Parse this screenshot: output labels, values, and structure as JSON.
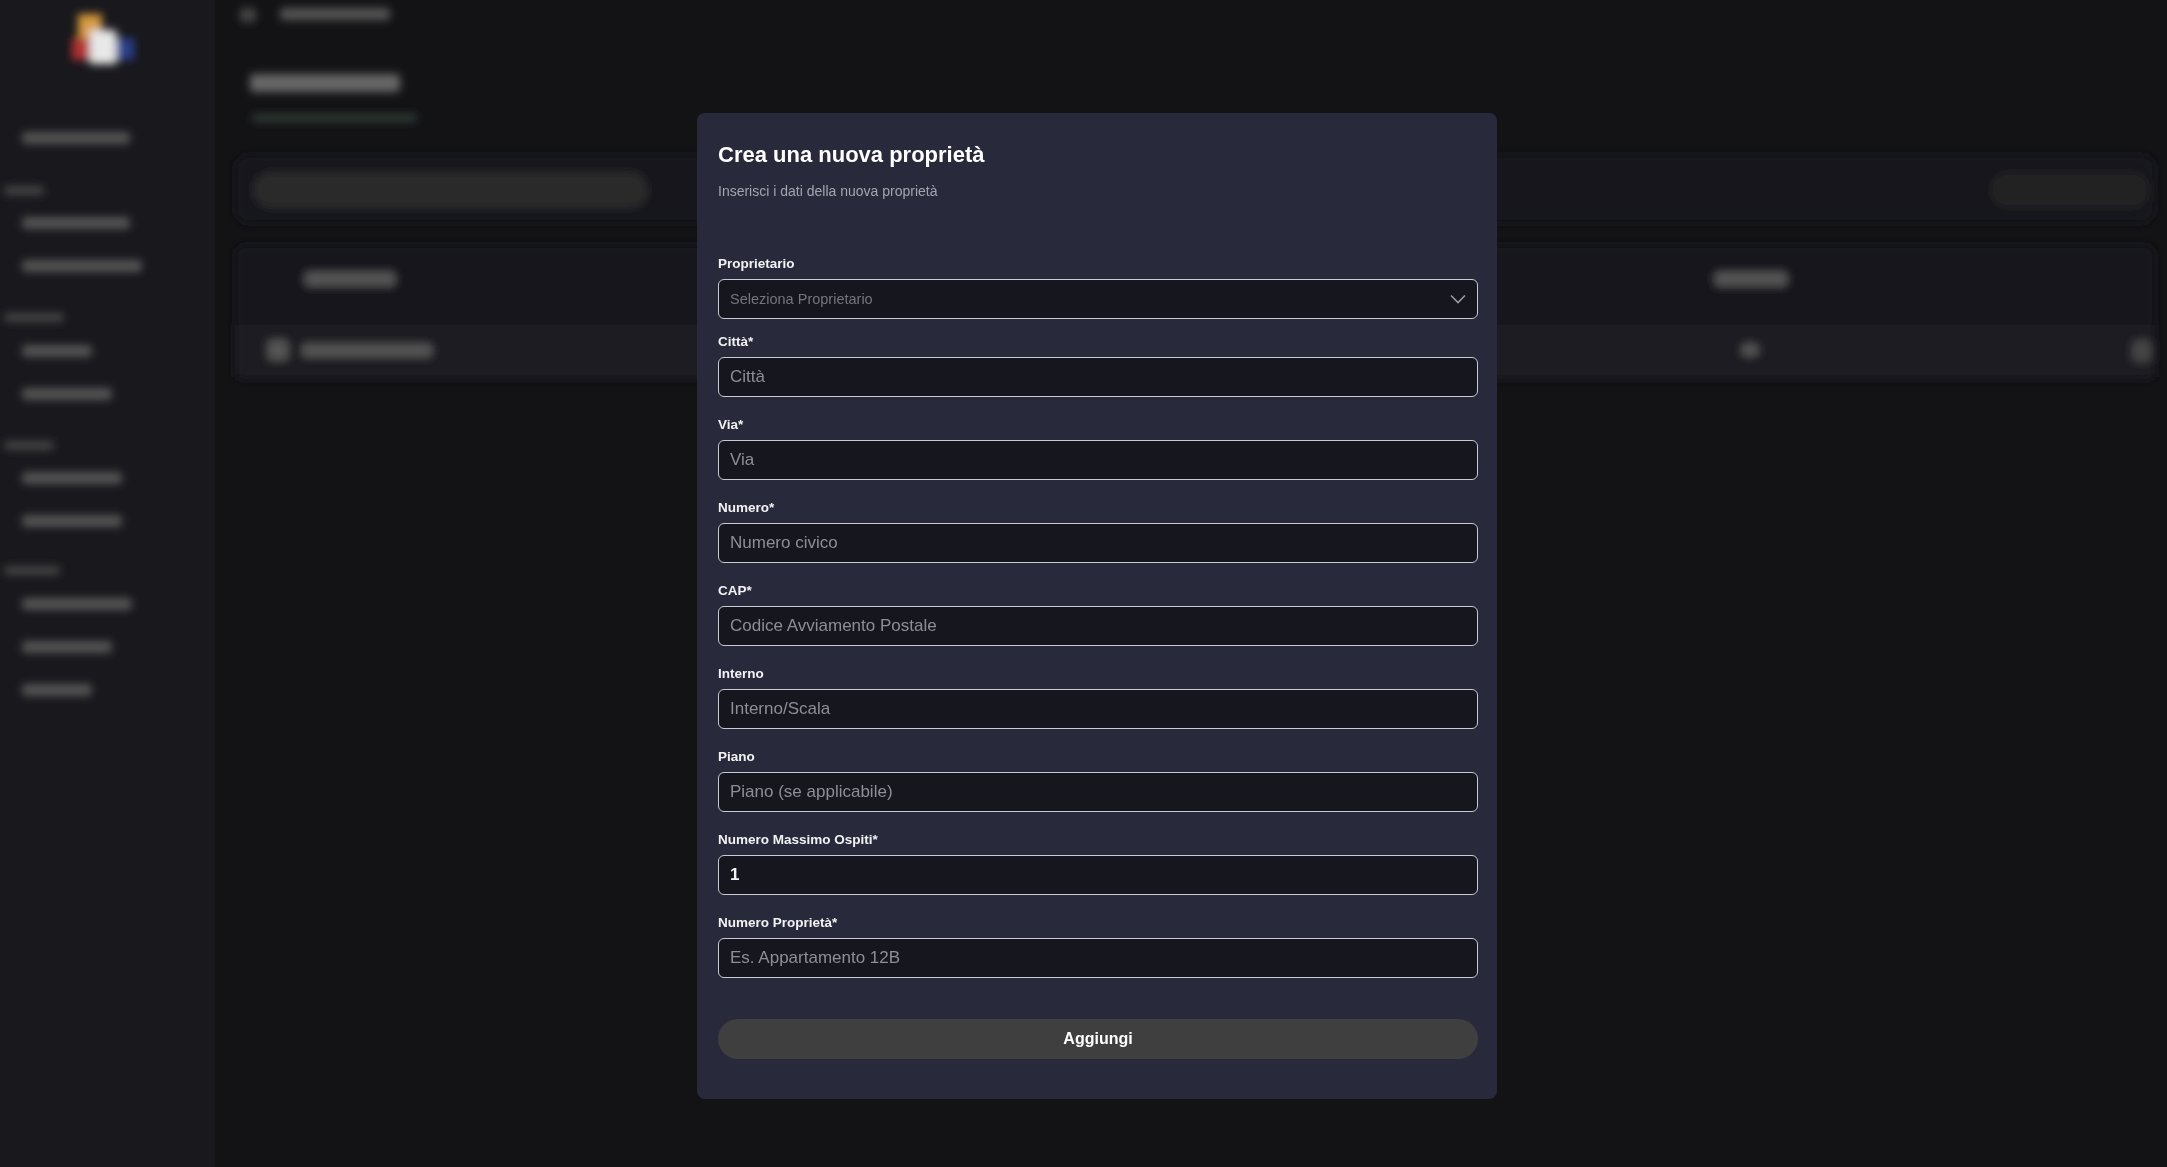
{
  "modal": {
    "title": "Crea una nuova proprietà",
    "subtitle": "Inserisci i dati della nuova proprietà",
    "fields": [
      {
        "kind": "select",
        "label": "Proprietario",
        "placeholder": "Seleziona Proprietario"
      },
      {
        "kind": "input",
        "label": "Città*",
        "placeholder": "Città"
      },
      {
        "kind": "input",
        "label": "Via*",
        "placeholder": "Via"
      },
      {
        "kind": "input",
        "label": "Numero*",
        "placeholder": "Numero civico"
      },
      {
        "kind": "input",
        "label": "CAP*",
        "placeholder": "Codice Avviamento Postale"
      },
      {
        "kind": "input",
        "label": "Interno",
        "placeholder": "Interno/Scala"
      },
      {
        "kind": "input",
        "label": "Piano",
        "placeholder": "Piano (se applicabile)"
      },
      {
        "kind": "input",
        "label": "Numero Massimo Ospiti*",
        "value": "1"
      },
      {
        "kind": "input",
        "label": "Numero Proprietà*",
        "placeholder": "Es. Appartamento 12B"
      }
    ],
    "button": "Aggiungi"
  }
}
